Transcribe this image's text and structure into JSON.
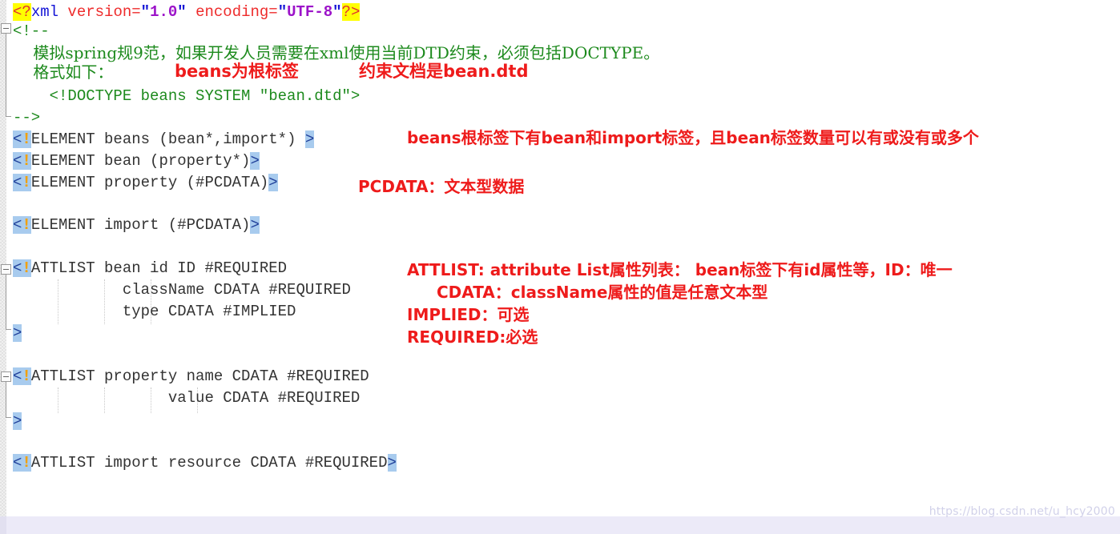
{
  "editor": {
    "language": "xml-dtd",
    "watermark": "https://blog.csdn.net/u_hcy2000"
  },
  "code_lines": [
    {
      "id": "xml-declaration",
      "segments": [
        {
          "kind": "procmark",
          "text": "<?"
        },
        {
          "kind": "proctag",
          "text": "xml"
        },
        {
          "kind": "attr",
          "text": " version="
        },
        {
          "kind": "quote",
          "text": "\""
        },
        {
          "kind": "val",
          "text": "1.0"
        },
        {
          "kind": "quote",
          "text": "\""
        },
        {
          "kind": "attr",
          "text": " encoding="
        },
        {
          "kind": "quote",
          "text": "\""
        },
        {
          "kind": "val",
          "text": "UTF-8"
        },
        {
          "kind": "quote",
          "text": "\""
        },
        {
          "kind": "procmark",
          "text": "?>"
        }
      ]
    },
    {
      "id": "comment-open",
      "text": "<!--"
    },
    {
      "id": "comment-line-1",
      "text": "    模拟spring规9范，如果开发人员需要在xml使用当前DTD约束，必须包括DOCTYPE。"
    },
    {
      "id": "comment-line-2",
      "text": "    格式如下："
    },
    {
      "id": "comment-line-3",
      "text": "    <!DOCTYPE beans SYSTEM \"bean.dtd\">"
    },
    {
      "id": "comment-close",
      "text": "-->"
    },
    {
      "id": "element-beans",
      "open": "<!",
      "body": "ELEMENT beans (bean*,import*) ",
      "close": ">"
    },
    {
      "id": "element-bean",
      "open": "<!",
      "body": "ELEMENT bean (property*)",
      "close": ">"
    },
    {
      "id": "element-property",
      "open": "<!",
      "body": "ELEMENT property (#PCDATA)",
      "close": ">"
    },
    {
      "id": "element-import",
      "open": "<!",
      "body": "ELEMENT import (#PCDATA)",
      "close": ">"
    },
    {
      "id": "attlist-bean-1",
      "open": "<!",
      "body": "ATTLIST bean id ID #REQUIRED",
      "close": ""
    },
    {
      "id": "attlist-bean-2",
      "open": "",
      "body": "            className CDATA #REQUIRED",
      "close": ""
    },
    {
      "id": "attlist-bean-3",
      "open": "",
      "body": "            type CDATA #IMPLIED",
      "close": ""
    },
    {
      "id": "attlist-bean-end",
      "open": "",
      "body": "",
      "close": ">"
    },
    {
      "id": "attlist-property-1",
      "open": "<!",
      "body": "ATTLIST property name CDATA #REQUIRED",
      "close": ""
    },
    {
      "id": "attlist-property-2",
      "open": "",
      "body": "                 value CDATA #REQUIRED",
      "close": ""
    },
    {
      "id": "attlist-property-end",
      "open": "",
      "body": "",
      "close": ">"
    },
    {
      "id": "attlist-import",
      "open": "<!",
      "body": "ATTLIST import resource CDATA #REQUIRED",
      "close": ">"
    }
  ],
  "annotations": [
    {
      "id": "anno-beans-root",
      "text": "beans为根标签"
    },
    {
      "id": "anno-dtd-doc",
      "text": "约束文档是bean.dtd"
    },
    {
      "id": "anno-beans-detail",
      "text": "beans根标签下有bean和import标签，且bean标签数量可以有或没有或多个"
    },
    {
      "id": "anno-pcdata",
      "text": "PCDATA：文本型数据"
    },
    {
      "id": "anno-attlist",
      "text": "ATTLIST: attribute List属性列表： bean标签下有id属性等，ID：唯一"
    },
    {
      "id": "anno-cdata",
      "text": "CDATA：className属性的值是任意文本型"
    },
    {
      "id": "anno-implied",
      "text": "IMPLIED：可选"
    },
    {
      "id": "anno-required",
      "text": "REQUIRED:必选"
    }
  ],
  "colors": {
    "highlight_yellow": "#ffff00",
    "decl_bracket_blue": "#a8cbee",
    "comment_green": "#1d8a1d",
    "annotation_red": "#ee1b1b",
    "attr_red": "#ee2b2b",
    "value_purple": "#9c13c9",
    "tag_blue": "#1414d6"
  }
}
